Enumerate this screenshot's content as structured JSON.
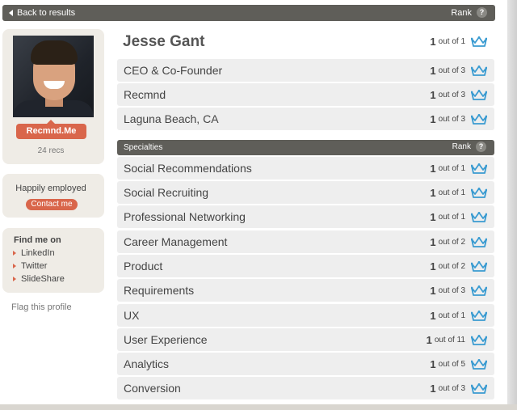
{
  "topbar": {
    "back_label": "Back to results",
    "rank_label": "Rank",
    "help_label": "?"
  },
  "profile": {
    "name": "Jesse Gant",
    "name_rank": {
      "num": "1",
      "rest": "out of 1"
    },
    "recmnd_button": "Recmnd.Me",
    "recs": "24 recs",
    "status": "Happily employed",
    "contact_button": "Contact me",
    "find_me_title": "Find me on",
    "links": [
      "LinkedIn",
      "Twitter",
      "SlideShare"
    ],
    "flag": "Flag this profile"
  },
  "details": [
    {
      "label": "CEO & Co-Founder",
      "num": "1",
      "rest": "out of 3"
    },
    {
      "label": "Recmnd",
      "num": "1",
      "rest": "out of 3"
    },
    {
      "label": "Laguna Beach, CA",
      "num": "1",
      "rest": "out of 3"
    }
  ],
  "specialties_header": {
    "label": "Specialties",
    "rank_label": "Rank",
    "help_label": "?"
  },
  "specialties": [
    {
      "label": "Social Recommendations",
      "num": "1",
      "rest": "out of 1"
    },
    {
      "label": "Social Recruiting",
      "num": "1",
      "rest": "out of 1"
    },
    {
      "label": "Professional Networking",
      "num": "1",
      "rest": "out of 1"
    },
    {
      "label": "Career Management",
      "num": "1",
      "rest": "out of 2"
    },
    {
      "label": "Product",
      "num": "1",
      "rest": "out of 2"
    },
    {
      "label": "Requirements",
      "num": "1",
      "rest": "out of 3"
    },
    {
      "label": "UX",
      "num": "1",
      "rest": "out of 1"
    },
    {
      "label": "User Experience",
      "num": "1",
      "rest": "out of 11"
    },
    {
      "label": "Analytics",
      "num": "1",
      "rest": "out of 5"
    },
    {
      "label": "Conversion",
      "num": "1",
      "rest": "out of 3"
    }
  ],
  "colors": {
    "accent": "#d9664b",
    "bar": "#5f5e59",
    "crown": "#3a9bd1"
  },
  "icons": {
    "crown": "crown-icon",
    "back": "caret-left-icon",
    "bullet": "caret-right-icon"
  }
}
